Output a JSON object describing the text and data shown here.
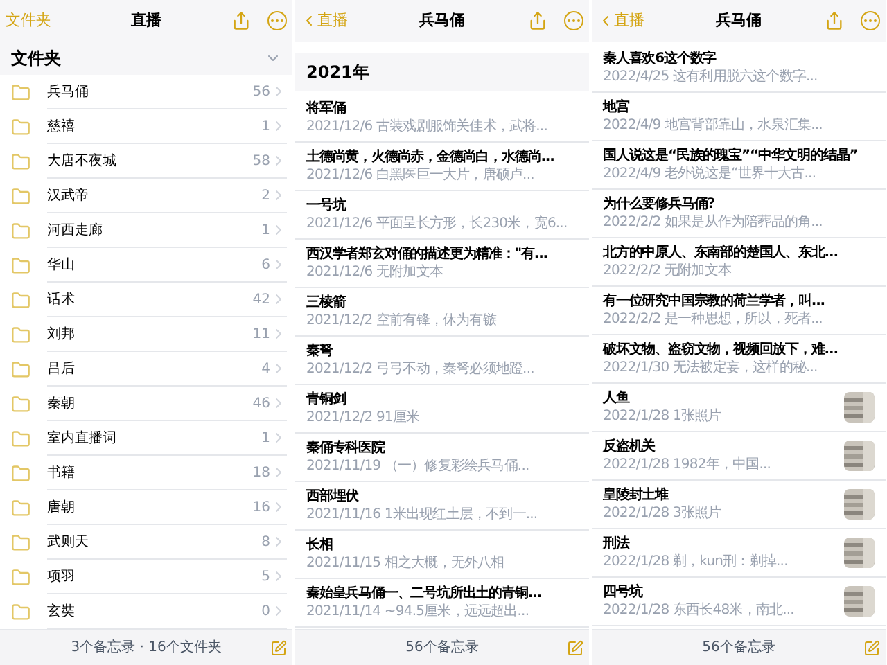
{
  "panels": [
    {
      "kind": "folders",
      "nav": {
        "back": "文件夹",
        "title": "直播"
      },
      "section": "文件夹",
      "folders": [
        {
          "name": "兵马俑",
          "count": "56"
        },
        {
          "name": "慈禧",
          "count": "1"
        },
        {
          "name": "大唐不夜城",
          "count": "58"
        },
        {
          "name": "汉武帝",
          "count": "2"
        },
        {
          "name": "河西走廊",
          "count": "1"
        },
        {
          "name": "华山",
          "count": "6"
        },
        {
          "name": "话术",
          "count": "42"
        },
        {
          "name": "刘邦",
          "count": "11"
        },
        {
          "name": "吕后",
          "count": "4"
        },
        {
          "name": "秦朝",
          "count": "46"
        },
        {
          "name": "室内直播词",
          "count": "1"
        },
        {
          "name": "书籍",
          "count": "18"
        },
        {
          "name": "唐朝",
          "count": "16"
        },
        {
          "name": "武则天",
          "count": "8"
        },
        {
          "name": "项羽",
          "count": "5"
        },
        {
          "name": "玄奘",
          "count": "0"
        }
      ],
      "footer": "3个备忘录 · 16个文件夹"
    },
    {
      "kind": "notes",
      "nav": {
        "back": "直播",
        "title": "兵马俑"
      },
      "section": "2021年",
      "notes": [
        {
          "title": "将军俑",
          "subtitle": "2021/12/6 古装戏剧服饰关佳术，武将...",
          "photo": false
        },
        {
          "title": "土德尚黄，火德尚赤，金德尚白，水德尚...",
          "subtitle": "2021/12/6 白黑医巨一大片，唐硕卢...",
          "photo": false
        },
        {
          "title": "一号坑",
          "subtitle": "2021/12/6 平面呈长方形，长230米，宽6...",
          "photo": false
        },
        {
          "title": "西汉学者郑玄对俑的描述更为精准：\"有...",
          "subtitle": "2021/12/6 无附加文本",
          "photo": false
        },
        {
          "title": "三棱箭",
          "subtitle": "2021/12/2 空前有锋，休为有镞",
          "photo": false
        },
        {
          "title": "秦弩",
          "subtitle": "2021/12/2 弓弓不动，秦弩必须地蹬...",
          "photo": false
        },
        {
          "title": "青铜剑",
          "subtitle": "2021/12/2 91厘米",
          "photo": false
        },
        {
          "title": "秦俑专科医院",
          "subtitle": "2021/11/19 （一）修复彩绘兵马俑...",
          "photo": false
        },
        {
          "title": "西部埋伏",
          "subtitle": "2021/11/16 1米出现红土层，不到一...",
          "photo": false
        },
        {
          "title": "长相",
          "subtitle": "2021/11/15 相之大概，无外八相",
          "photo": false
        },
        {
          "title": "秦始皇兵马俑一、二号坑所出土的青铜...",
          "subtitle": "2021/11/14 ~94.5厘米，远远超出...",
          "photo": false
        }
      ],
      "footer": "56个备忘录"
    },
    {
      "kind": "notes",
      "nav": {
        "back": "直播",
        "title": "兵马俑"
      },
      "notes": [
        {
          "title": "秦人喜欢6这个数字",
          "subtitle": "2022/4/25 这有利用脱六这个数字...",
          "photo": false
        },
        {
          "title": "地宫",
          "subtitle": "2022/4/9 地宫背部靠山，水泉汇集...",
          "photo": false
        },
        {
          "title": "国人说这是“民族的瑰宝”“中华文明的结晶”",
          "subtitle": "2022/4/9 老外说这是“世界十大古...",
          "photo": false
        },
        {
          "title": "为什么要修兵马俑?",
          "subtitle": "2022/2/2 如果是从作为陪葬品的角...",
          "photo": false
        },
        {
          "title": "北方的中原人、东南部的楚国人、东北...",
          "subtitle": "2022/2/2 无附加文本",
          "photo": false
        },
        {
          "title": "有一位研究中国宗教的荷兰学者，叫...",
          "subtitle": "2022/2/2 是一种思想，所以，死者...",
          "photo": false
        },
        {
          "title": "破坏文物、盗窃文物，视频回放下，难...",
          "subtitle": "2022/1/30 无法被定妄，这样的秘...",
          "photo": false
        },
        {
          "title": "人鱼",
          "subtitle": "2022/1/28 1张照片",
          "photo": true
        },
        {
          "title": "反盗机关",
          "subtitle": "2022/1/28 1982年，中国...",
          "photo": true
        },
        {
          "title": "皇陵封土堆",
          "subtitle": "2022/1/28 3张照片",
          "photo": true
        },
        {
          "title": "刑法",
          "subtitle": "2022/1/28 剃，kun刑：剃掉...",
          "photo": true
        },
        {
          "title": "四号坑",
          "subtitle": "2022/1/28 东西长48米，南北...",
          "photo": true
        }
      ],
      "footer": "56个备忘录"
    }
  ]
}
